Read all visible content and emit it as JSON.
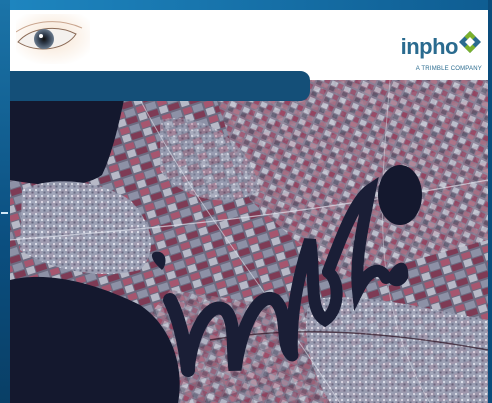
{
  "brand": {
    "wordmark": "inpho",
    "tagline": "A TRIMBLE COMPANY",
    "primary_color": "#2a6b8f",
    "diamond_colors": [
      "#7bb12d",
      "#2a6b8f"
    ]
  },
  "icons": {
    "header_eye": "eye-icon",
    "brand_mark": "diamond-icon"
  },
  "hero": {
    "overlay_script": "inpho",
    "image": "satellite-false-color-map"
  }
}
